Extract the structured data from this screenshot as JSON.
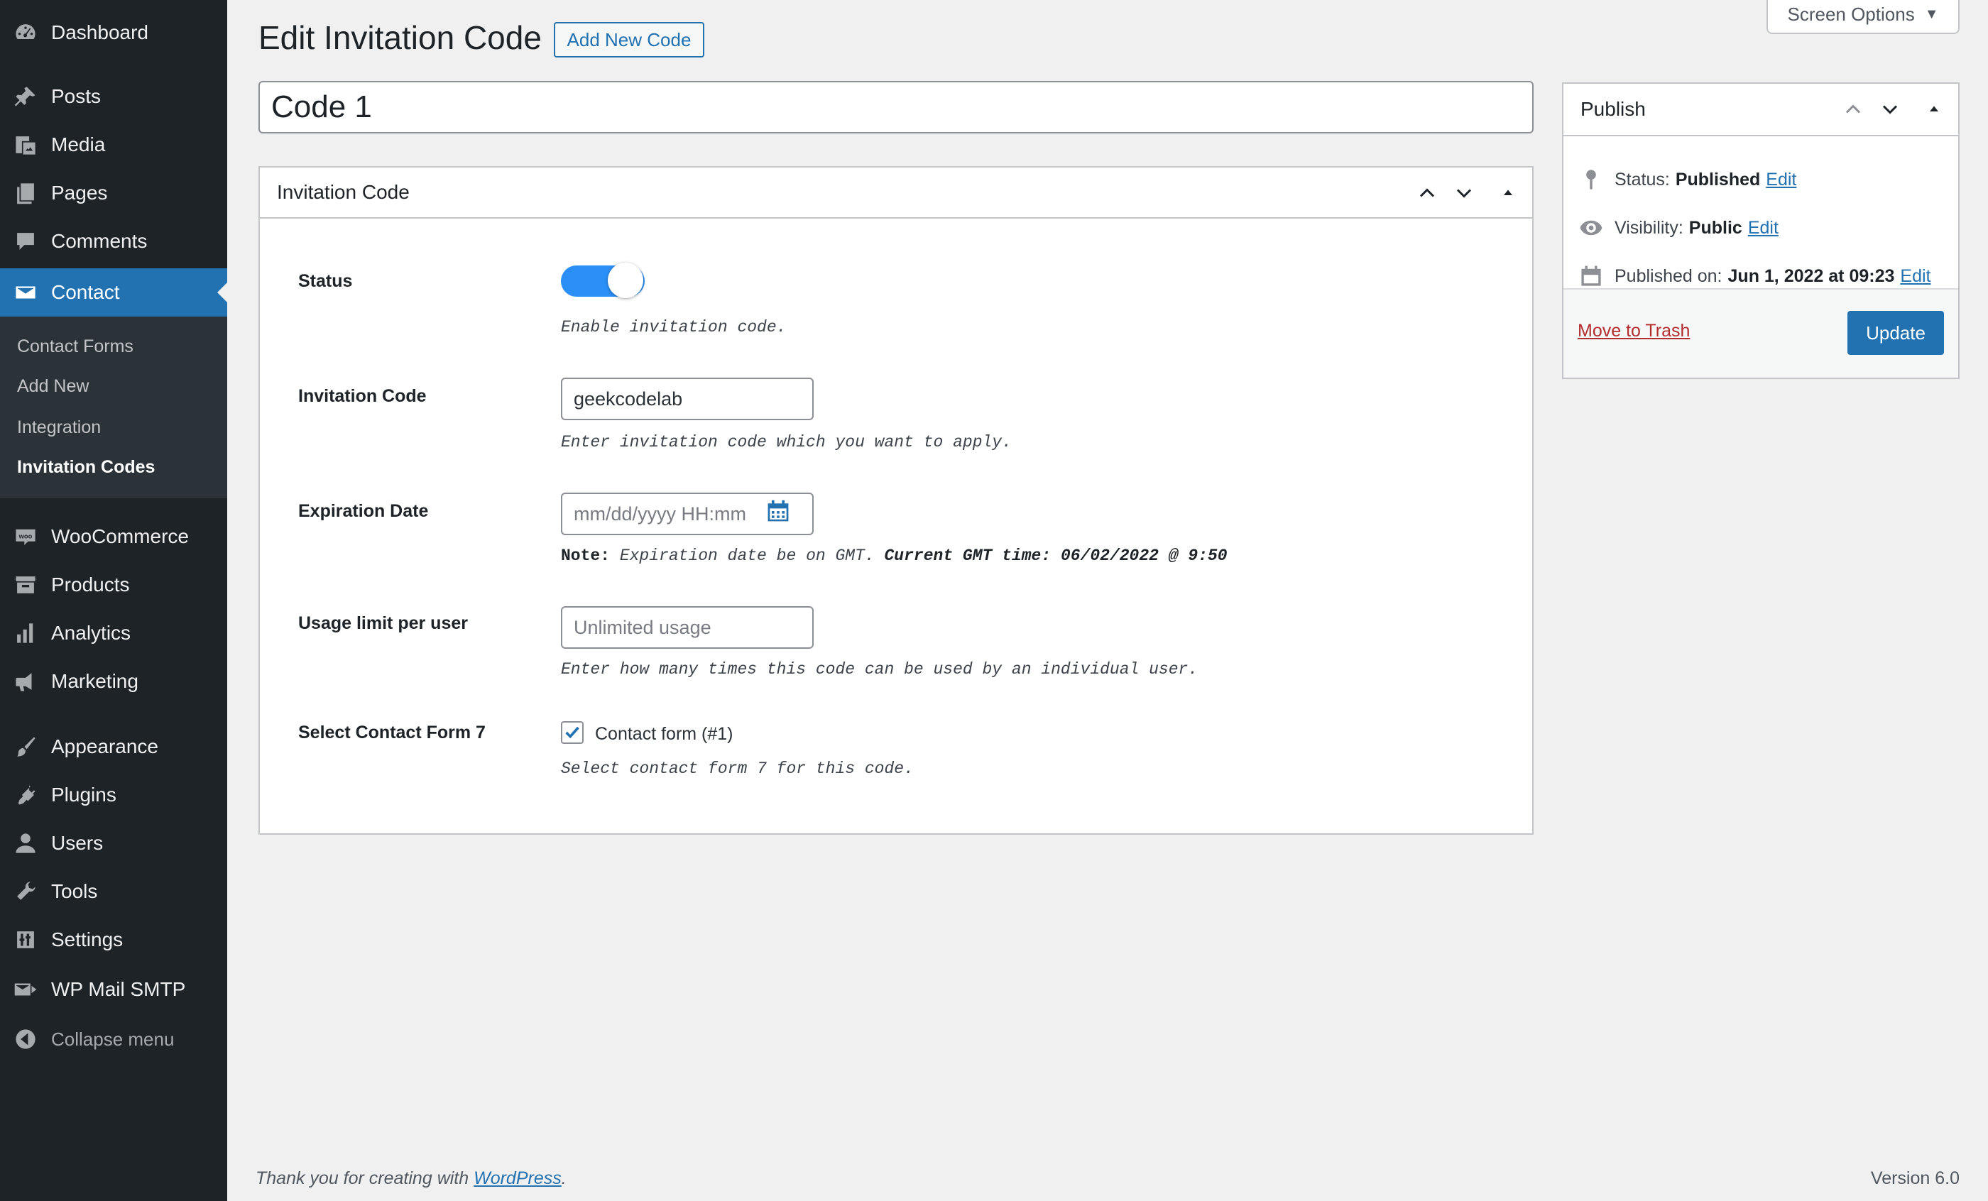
{
  "sidebar": {
    "items": [
      {
        "label": "Dashboard",
        "icon": "dashboard-icon"
      },
      {
        "label": "Posts",
        "icon": "pushpin-icon"
      },
      {
        "label": "Media",
        "icon": "media-icon"
      },
      {
        "label": "Pages",
        "icon": "pages-icon"
      },
      {
        "label": "Comments",
        "icon": "comment-icon"
      },
      {
        "label": "Contact",
        "icon": "envelope-icon",
        "active": true
      },
      {
        "label": "WooCommerce",
        "icon": "woo-icon"
      },
      {
        "label": "Products",
        "icon": "archive-icon"
      },
      {
        "label": "Analytics",
        "icon": "bar-chart-icon"
      },
      {
        "label": "Marketing",
        "icon": "megaphone-icon"
      },
      {
        "label": "Appearance",
        "icon": "paintbrush-icon"
      },
      {
        "label": "Plugins",
        "icon": "plug-icon"
      },
      {
        "label": "Users",
        "icon": "user-icon"
      },
      {
        "label": "Tools",
        "icon": "wrench-icon"
      },
      {
        "label": "Settings",
        "icon": "sliders-icon"
      },
      {
        "label": "WP Mail SMTP",
        "icon": "mail-smtp-icon"
      }
    ],
    "submenu": [
      "Contact Forms",
      "Add New",
      "Integration",
      "Invitation Codes"
    ],
    "collapse_label": "Collapse menu"
  },
  "header": {
    "title": "Edit Invitation Code",
    "add_new_label": "Add New Code",
    "screen_options_label": "Screen Options"
  },
  "post_title": "Code 1",
  "invitation_box": {
    "title": "Invitation Code",
    "status": {
      "label": "Status",
      "enabled": true,
      "description": "Enable invitation code."
    },
    "code": {
      "label": "Invitation Code",
      "value": "geekcodelab",
      "description": "Enter invitation code which you want to apply."
    },
    "expiration": {
      "label": "Expiration Date",
      "placeholder": "mm/dd/yyyy HH:mm",
      "note_prefix": "Note:",
      "note_text": "Expiration date be on GMT.",
      "current_time": "Current GMT time: 06/02/2022 @ 9:50"
    },
    "usage_limit": {
      "label": "Usage limit per user",
      "placeholder": "Unlimited usage",
      "description": "Enter how many times this code can be used by an individual user."
    },
    "contact_form": {
      "label": "Select Contact Form 7",
      "option_label": "Contact form (#1)",
      "checked": true,
      "description": "Select contact form 7 for this code."
    }
  },
  "publish_box": {
    "title": "Publish",
    "status_label": "Status:",
    "status_value": "Published",
    "visibility_label": "Visibility:",
    "visibility_value": "Public",
    "published_label": "Published on:",
    "published_value": "Jun 1, 2022 at 09:23",
    "edit_label": "Edit",
    "trash_label": "Move to Trash",
    "update_label": "Update"
  },
  "footer": {
    "thanks_text": "Thank you for creating with",
    "wordpress_link": "WordPress",
    "period": ".",
    "version": "Version 6.0"
  },
  "colors": {
    "sidebar_bg": "#1d2327",
    "accent": "#2271b1",
    "toggle_on": "#2a8ff7",
    "trash": "#b32d2e"
  }
}
